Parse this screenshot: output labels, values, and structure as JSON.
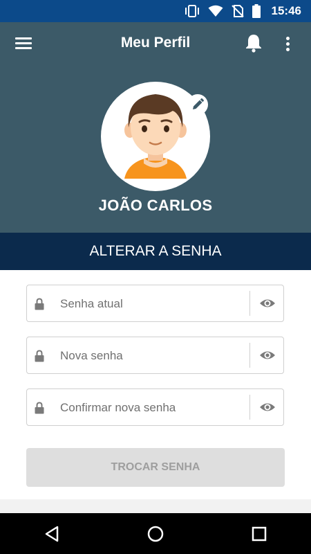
{
  "status_bar": {
    "time": "15:46",
    "icons": [
      "vibrate-icon",
      "wifi-icon",
      "no-sim-icon",
      "battery-icon"
    ]
  },
  "header": {
    "title": "Meu Perfil",
    "user_name": "JOÃO CARLOS",
    "background_color": "#3c5a68",
    "icons": [
      "menu-icon",
      "bell-icon",
      "more-vert-icon",
      "edit-pencil-icon"
    ]
  },
  "section": {
    "title": "ALTERAR A SENHA",
    "background_color": "#0b2a4c"
  },
  "form": {
    "current_password": {
      "value": "",
      "placeholder": "Senha atual"
    },
    "new_password": {
      "value": "",
      "placeholder": "Nova senha"
    },
    "confirm_password": {
      "value": "",
      "placeholder": "Confirmar nova senha"
    },
    "submit_label": "TROCAR SENHA"
  },
  "nav_bar": {
    "icons": [
      "back-triangle-icon",
      "home-circle-icon",
      "recents-square-icon"
    ]
  }
}
